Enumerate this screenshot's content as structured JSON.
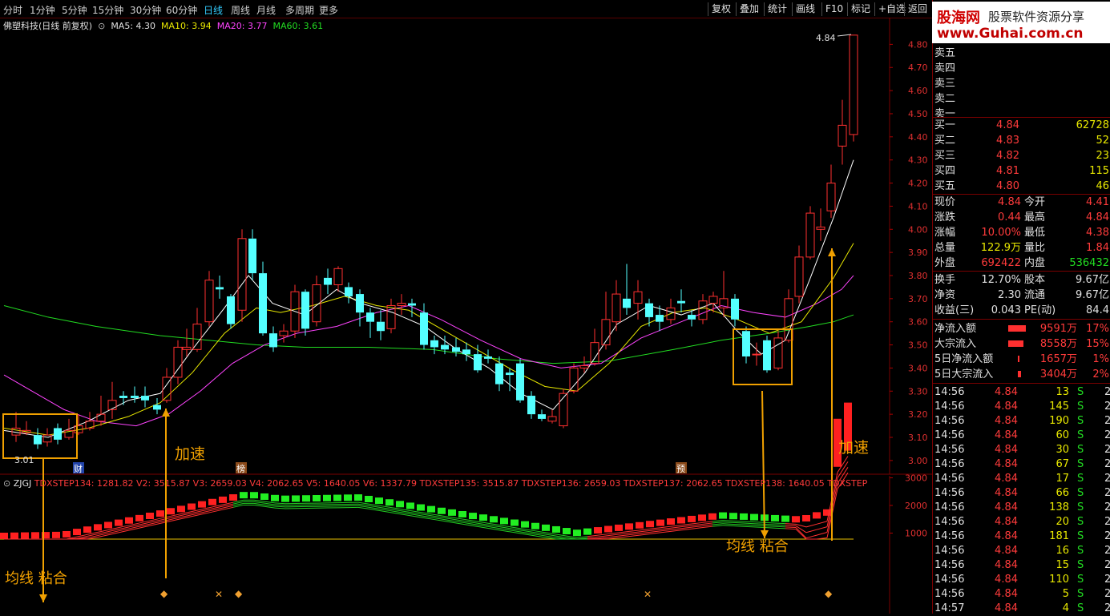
{
  "toolbar": {
    "periods": [
      "分时",
      "1分钟",
      "5分钟",
      "15分钟",
      "30分钟",
      "60分钟",
      "日线",
      "周线",
      "月线",
      "多周期",
      "更多"
    ],
    "active_period": "日线",
    "buttons": [
      "复权",
      "叠加",
      "统计",
      "画线",
      "F10",
      "标记",
      "+自选",
      "返回"
    ]
  },
  "header": {
    "title": "佛塑科技(日线 前复权)",
    "ma5": "MA5: 4.30",
    "ma10": "MA10: 3.94",
    "ma20": "MA20: 3.77",
    "ma60": "MA60: 3.61"
  },
  "price_axis": [
    "4.80",
    "4.70",
    "4.60",
    "4.50",
    "4.40",
    "4.30",
    "4.20",
    "4.10",
    "4.00",
    "3.90",
    "3.80",
    "3.70",
    "3.60",
    "3.50",
    "3.40",
    "3.30",
    "3.20",
    "3.10",
    "3.00"
  ],
  "labels": {
    "high_mark": "4.84",
    "low_mark": "3.01",
    "accel_left": "加速",
    "accel_right": "加速",
    "stick_left": "均线 粘合",
    "stick_right": "均线 粘合",
    "tag_cai": "财",
    "tag_bang": "榜",
    "tag_yu": "预"
  },
  "indicator": {
    "name": "ZJGJ",
    "line": "TDXSTEP134: 1281.82  V2: 3515.87  V3: 2659.03  V4: 2062.65  V5: 1640.05  V6: 1337.79  TDXSTEP135: 3515.87  TDXSTEP136: 2659.03  TDXSTEP137: 2062.65  TDXSTEP138: 1640.05  TDXSTEP",
    "axis": [
      "3000",
      "2000",
      "1000"
    ]
  },
  "logo": {
    "brand": "股海网",
    "tagline": "股票软件资源分享",
    "url": "www.Guhai.com.cn"
  },
  "quote": {
    "sells": [
      {
        "label": "卖五",
        "price": "",
        "vol": ""
      },
      {
        "label": "卖四",
        "price": "",
        "vol": ""
      },
      {
        "label": "卖三",
        "price": "",
        "vol": ""
      },
      {
        "label": "卖二",
        "price": "",
        "vol": ""
      },
      {
        "label": "卖一",
        "price": "",
        "vol": ""
      }
    ],
    "buys": [
      {
        "label": "买一",
        "price": "4.84",
        "vol": "62728"
      },
      {
        "label": "买二",
        "price": "4.83",
        "vol": "52"
      },
      {
        "label": "买三",
        "price": "4.82",
        "vol": "23"
      },
      {
        "label": "买四",
        "price": "4.81",
        "vol": "115"
      },
      {
        "label": "买五",
        "price": "4.80",
        "vol": "46"
      }
    ],
    "stats1": [
      {
        "l1": "现价",
        "v1": "4.84",
        "l2": "今开",
        "v2": "4.41"
      },
      {
        "l1": "涨跌",
        "v1": "0.44",
        "l2": "最高",
        "v2": "4.84"
      },
      {
        "l1": "涨幅",
        "v1": "10.00%",
        "l2": "最低",
        "v2": "4.38"
      },
      {
        "l1": "总量",
        "v1": "122.9万",
        "l2": "量比",
        "v2": "1.84"
      },
      {
        "l1": "外盘",
        "v1": "692422",
        "l2": "内盘",
        "v2": "536432"
      }
    ],
    "stats2": [
      {
        "l1": "换手",
        "v1": "12.70%",
        "l2": "股本",
        "v2": "9.67亿"
      },
      {
        "l1": "净资",
        "v1": "2.30",
        "l2": "流通",
        "v2": "9.67亿"
      },
      {
        "l1": "收益(三)",
        "v1": "0.043",
        "l2": "PE(动)",
        "v2": "84.4"
      }
    ],
    "flows": [
      {
        "label": "净流入额",
        "value": "9591万",
        "pct": "17%",
        "bar": 0.9
      },
      {
        "label": "大宗流入",
        "value": "8558万",
        "pct": "15%",
        "bar": 0.8
      },
      {
        "label": "5日净流入额",
        "value": "1657万",
        "pct": "1%",
        "bar": 0.1
      },
      {
        "label": "5日大宗流入",
        "value": "3404万",
        "pct": "2%",
        "bar": 0.15
      }
    ],
    "ticks": [
      {
        "t": "14:56",
        "p": "4.84",
        "v": "13",
        "s": "S"
      },
      {
        "t": "14:56",
        "p": "4.84",
        "v": "145",
        "s": "S"
      },
      {
        "t": "14:56",
        "p": "4.84",
        "v": "190",
        "s": "S"
      },
      {
        "t": "14:56",
        "p": "4.84",
        "v": "60",
        "s": "S"
      },
      {
        "t": "14:56",
        "p": "4.84",
        "v": "30",
        "s": "S"
      },
      {
        "t": "14:56",
        "p": "4.84",
        "v": "67",
        "s": "S"
      },
      {
        "t": "14:56",
        "p": "4.84",
        "v": "17",
        "s": "S"
      },
      {
        "t": "14:56",
        "p": "4.84",
        "v": "66",
        "s": "S"
      },
      {
        "t": "14:56",
        "p": "4.84",
        "v": "138",
        "s": "S"
      },
      {
        "t": "14:56",
        "p": "4.84",
        "v": "20",
        "s": "S"
      },
      {
        "t": "14:56",
        "p": "4.84",
        "v": "181",
        "s": "S"
      },
      {
        "t": "14:56",
        "p": "4.84",
        "v": "16",
        "s": "S"
      },
      {
        "t": "14:56",
        "p": "4.84",
        "v": "15",
        "s": "S"
      },
      {
        "t": "14:56",
        "p": "4.84",
        "v": "110",
        "s": "S"
      },
      {
        "t": "14:56",
        "p": "4.84",
        "v": "5",
        "s": "S"
      },
      {
        "t": "14:57",
        "p": "4.84",
        "v": "4",
        "s": "S"
      }
    ]
  }
}
